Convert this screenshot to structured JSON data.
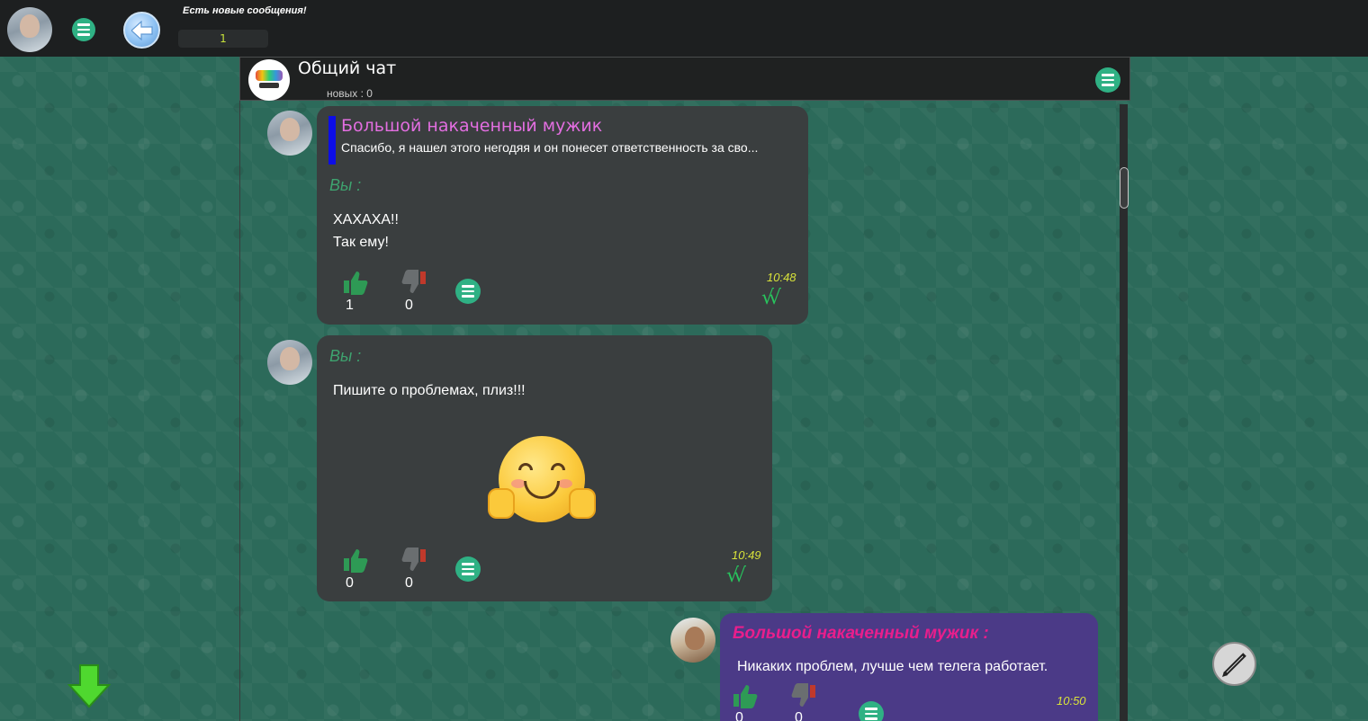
{
  "topbar": {
    "notice": "Есть новые сообщения!",
    "notice_count": "1"
  },
  "chat": {
    "title": "Общий чат",
    "new_label": "новых : 0"
  },
  "messages": [
    {
      "quote_author": "Большой накаченный мужик",
      "quote_text": "Спасибо, я нашел этого негодяя и он понесет ответственность за сво...",
      "sender": "Вы :",
      "lines": [
        "ХАХАХА!!",
        "Так ему!"
      ],
      "likes": "1",
      "dislikes": "0",
      "time": "10:48",
      "status": "√√"
    },
    {
      "sender": "Вы :",
      "lines": [
        "Пишите о проблемах, плиз!!!"
      ],
      "likes": "0",
      "dislikes": "0",
      "time": "10:49",
      "status": "√√"
    },
    {
      "sender": "Большой накаченный мужик :",
      "lines": [
        "Никаких проблем, лучше чем телега работает."
      ],
      "likes": "0",
      "dislikes": "0",
      "time": "10:50"
    }
  ],
  "colors": {
    "accent": "#2fb184",
    "own_bubble": "#3a3e3f",
    "other_bubble": "#4b3a87",
    "quote_author": "#e26ee0",
    "sender_own": "#3ea36f",
    "sender_other": "#e91e8c",
    "time": "#d8e23a"
  },
  "icons": [
    "menu-icon",
    "back-arrow-icon",
    "like-icon",
    "dislike-icon",
    "scroll-down-icon",
    "pencil-icon"
  ]
}
